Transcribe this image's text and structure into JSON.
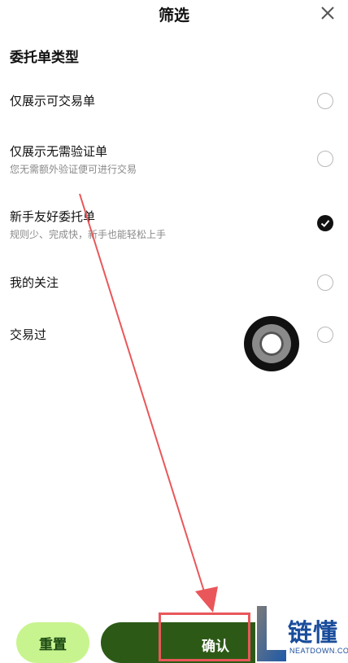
{
  "header": {
    "title": "筛选",
    "close_icon": "close-icon"
  },
  "section": {
    "title": "委托单类型"
  },
  "options": [
    {
      "label": "仅展示可交易单",
      "sublabel": "",
      "checked": false
    },
    {
      "label": "仅展示无需验证单",
      "sublabel": "您无需额外验证便可进行交易",
      "checked": false
    },
    {
      "label": "新手友好委托单",
      "sublabel": "规则少、完成快，新手也能轻松上手",
      "checked": true
    },
    {
      "label": "我的关注",
      "sublabel": "",
      "checked": false
    },
    {
      "label": "交易过",
      "sublabel": "",
      "checked": false
    }
  ],
  "footer": {
    "reset_label": "重置",
    "confirm_label": "确认"
  },
  "watermark": {
    "cn": "链懂",
    "en": "NEATDOWN.COM"
  },
  "colors": {
    "reset_bg": "#c8f48f",
    "confirm_bg": "#2c5a16",
    "annotation_red": "#e9575a",
    "watermark_blue": "#1a4d9b"
  }
}
